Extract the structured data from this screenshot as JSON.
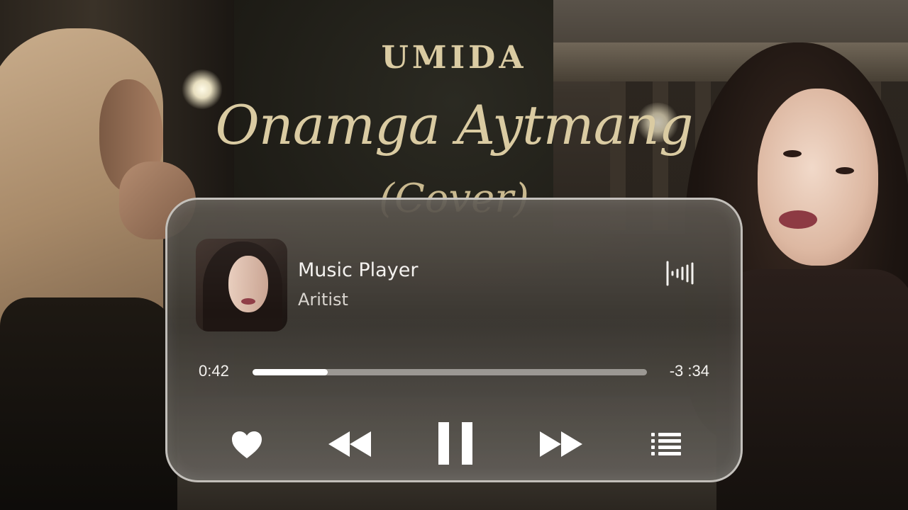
{
  "background": {
    "artist_title": "UMIDA",
    "song_title": "Onamga Aytmang",
    "song_subtitle": "(Cover)"
  },
  "player": {
    "track_title": "Music Player",
    "track_artist": "Aritist",
    "time_elapsed": "0:42",
    "time_remaining": "-3 :34",
    "progress": 0.19,
    "controls": {
      "like": "heart-icon",
      "previous": "rewind-icon",
      "play_pause": "pause-icon",
      "next": "fast-forward-icon",
      "playlist": "list-icon",
      "visualizer": "waveform-icon"
    }
  }
}
